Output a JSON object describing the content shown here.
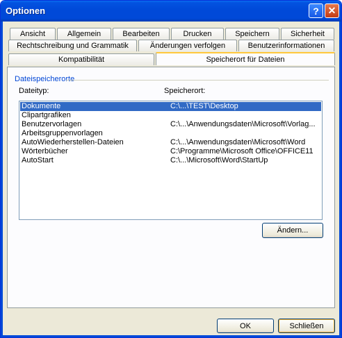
{
  "window": {
    "title": "Optionen"
  },
  "titlebar_buttons": {
    "help": "?",
    "close": "✕"
  },
  "tabs_row1": [
    "Ansicht",
    "Allgemein",
    "Bearbeiten",
    "Drucken",
    "Speichern",
    "Sicherheit"
  ],
  "tabs_row2": [
    "Rechtschreibung und Grammatik",
    "Änderungen verfolgen",
    "Benutzerinformationen"
  ],
  "tabs_row3": [
    "Kompatibilität",
    "Speicherort für Dateien"
  ],
  "panel": {
    "group_title": "Dateispeicherorte",
    "col_type": "Dateityp:",
    "col_location": "Speicherort:",
    "rows": [
      {
        "type": "Dokumente",
        "location": "C:\\...\\TEST\\Desktop",
        "selected": true
      },
      {
        "type": "Clipartgrafiken",
        "location": ""
      },
      {
        "type": "Benutzervorlagen",
        "location": "C:\\...\\Anwendungsdaten\\Microsoft\\Vorlag..."
      },
      {
        "type": "Arbeitsgruppenvorlagen",
        "location": ""
      },
      {
        "type": "AutoWiederherstellen-Dateien",
        "location": "C:\\...\\Anwendungsdaten\\Microsoft\\Word"
      },
      {
        "type": "Wörterbücher",
        "location": "C:\\Programme\\Microsoft Office\\OFFICE11"
      },
      {
        "type": "AutoStart",
        "location": "C:\\...\\Microsoft\\Word\\StartUp"
      }
    ],
    "change_button": "Ändern..."
  },
  "footer": {
    "ok": "OK",
    "close": "Schließen"
  }
}
